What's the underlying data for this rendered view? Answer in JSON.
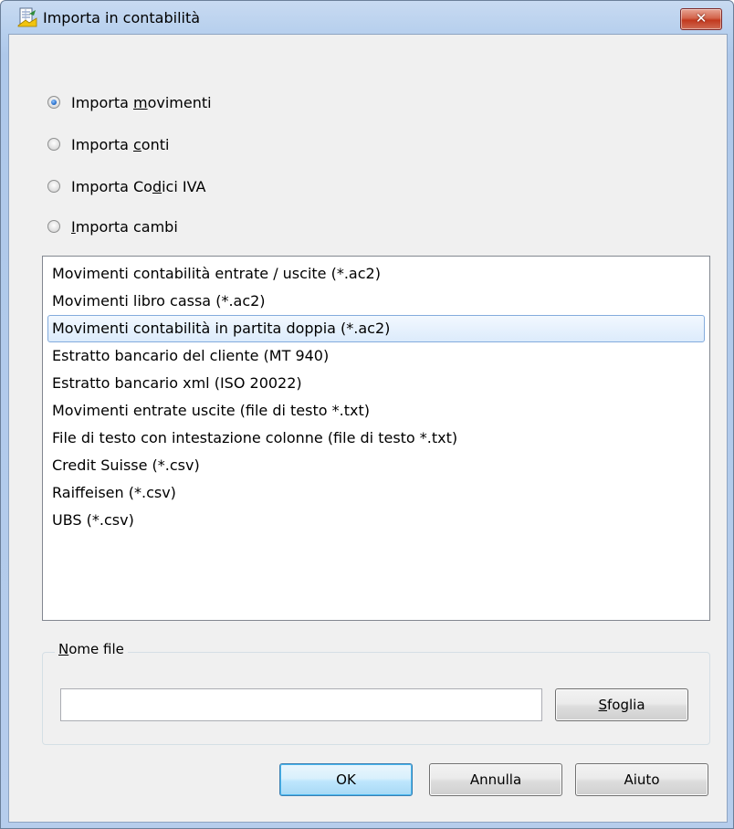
{
  "window": {
    "title": "Importa in contabilità",
    "close_glyph": "✕"
  },
  "options": [
    {
      "pre": "Importa ",
      "key": "m",
      "post": "ovimenti",
      "checked": true
    },
    {
      "pre": "Importa ",
      "key": "c",
      "post": "onti",
      "checked": false
    },
    {
      "pre": "Importa Co",
      "key": "d",
      "post": "ici IVA",
      "checked": false
    },
    {
      "pre": "",
      "key": "I",
      "post": "mporta cambi",
      "checked": false
    }
  ],
  "list_items": [
    "Movimenti contabilità entrate / uscite (*.ac2)",
    "Movimenti libro cassa (*.ac2)",
    "Movimenti contabilità in partita doppia (*.ac2)",
    "Estratto bancario del cliente (MT 940)",
    "Estratto bancario xml (ISO 20022)",
    "Movimenti entrate uscite (file di testo *.txt)",
    "File di testo con intestazione colonne (file di testo *.txt)",
    "Credit Suisse (*.csv)",
    "Raiffeisen (*.csv)",
    "UBS (*.csv)"
  ],
  "selected_index": 2,
  "file_group": {
    "label_key": "N",
    "label_rest": "ome file",
    "value": ""
  },
  "browse": {
    "key": "S",
    "rest": "foglia"
  },
  "buttons": {
    "ok": "OK",
    "cancel": "Annulla",
    "help": "Aiuto"
  },
  "icons": {
    "app": "import-accounting-icon",
    "close": "close-icon"
  }
}
